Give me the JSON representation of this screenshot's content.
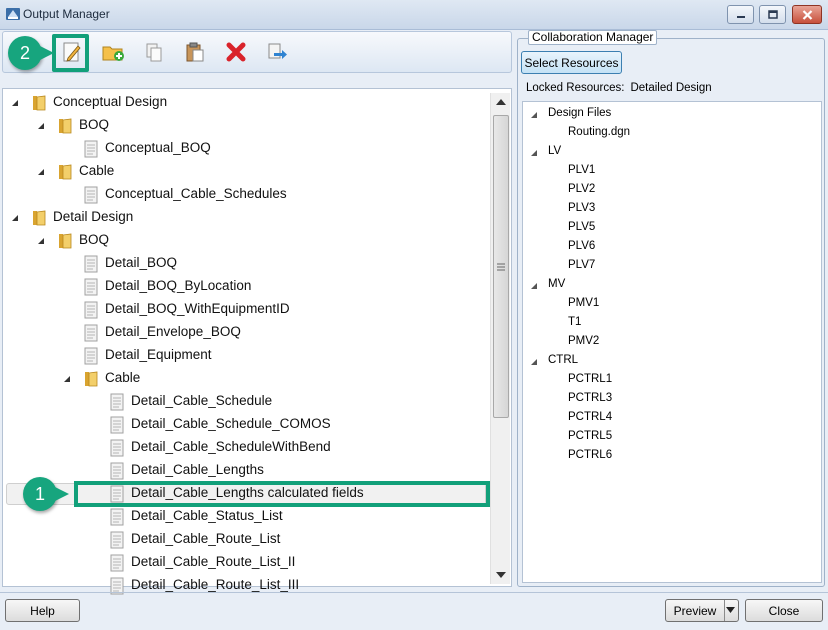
{
  "window": {
    "title": "Output Manager"
  },
  "toolbar": {
    "buttons": [
      {
        "icon": "edit-icon"
      },
      {
        "icon": "new-folder-icon"
      },
      {
        "icon": "copy-icon"
      },
      {
        "icon": "paste-icon"
      },
      {
        "icon": "delete-icon"
      },
      {
        "icon": "export-icon"
      }
    ]
  },
  "callouts": {
    "one": "1",
    "two": "2"
  },
  "tree": {
    "items": [
      {
        "label": "Conceptual Design",
        "type": "folder"
      },
      {
        "label": "BOQ",
        "type": "folder"
      },
      {
        "label": "Conceptual_BOQ",
        "type": "doc"
      },
      {
        "label": "Cable",
        "type": "folder"
      },
      {
        "label": "Conceptual_Cable_Schedules",
        "type": "doc"
      },
      {
        "label": "Detail Design",
        "type": "folder"
      },
      {
        "label": "BOQ",
        "type": "folder"
      },
      {
        "label": "Detail_BOQ",
        "type": "doc"
      },
      {
        "label": "Detail_BOQ_ByLocation",
        "type": "doc"
      },
      {
        "label": "Detail_BOQ_WithEquipmentID",
        "type": "doc"
      },
      {
        "label": "Detail_Envelope_BOQ",
        "type": "doc"
      },
      {
        "label": "Detail_Equipment",
        "type": "doc"
      },
      {
        "label": "Cable",
        "type": "folder"
      },
      {
        "label": "Detail_Cable_Schedule",
        "type": "doc"
      },
      {
        "label": "Detail_Cable_Schedule_COMOS",
        "type": "doc"
      },
      {
        "label": "Detail_Cable_ScheduleWithBend",
        "type": "doc"
      },
      {
        "label": "Detail_Cable_Lengths",
        "type": "doc"
      },
      {
        "label": "Detail_Cable_Lengths calculated fields",
        "type": "doc",
        "selected": true
      },
      {
        "label": "Detail_Cable_Status_List",
        "type": "doc"
      },
      {
        "label": "Detail_Cable_Route_List",
        "type": "doc"
      },
      {
        "label": "Detail_Cable_Route_List_II",
        "type": "doc"
      },
      {
        "label": "Detail_Cable_Route_List_III",
        "type": "doc"
      }
    ]
  },
  "collab": {
    "legend": "Collaboration Manager",
    "select_resources": "Select Resources",
    "locked_label": "Locked Resources:",
    "locked_value": "Detailed Design",
    "tree": [
      {
        "label": "Design Files",
        "kind": "group"
      },
      {
        "label": "Routing.dgn",
        "kind": "item"
      },
      {
        "label": "LV",
        "kind": "group"
      },
      {
        "label": "PLV1",
        "kind": "item"
      },
      {
        "label": "PLV2",
        "kind": "item"
      },
      {
        "label": "PLV3",
        "kind": "item"
      },
      {
        "label": "PLV5",
        "kind": "item"
      },
      {
        "label": "PLV6",
        "kind": "item"
      },
      {
        "label": "PLV7",
        "kind": "item"
      },
      {
        "label": "MV",
        "kind": "group"
      },
      {
        "label": "PMV1",
        "kind": "item"
      },
      {
        "label": "T1",
        "kind": "item"
      },
      {
        "label": "PMV2",
        "kind": "item"
      },
      {
        "label": "CTRL",
        "kind": "group"
      },
      {
        "label": "PCTRL1",
        "kind": "item"
      },
      {
        "label": "PCTRL3",
        "kind": "item"
      },
      {
        "label": "PCTRL4",
        "kind": "item"
      },
      {
        "label": "PCTRL5",
        "kind": "item"
      },
      {
        "label": "PCTRL6",
        "kind": "item"
      }
    ]
  },
  "footer": {
    "help": "Help",
    "preview": "Preview",
    "close": "Close"
  },
  "colors": {
    "highlight": "#12a07a",
    "callout": "#17a57e"
  }
}
